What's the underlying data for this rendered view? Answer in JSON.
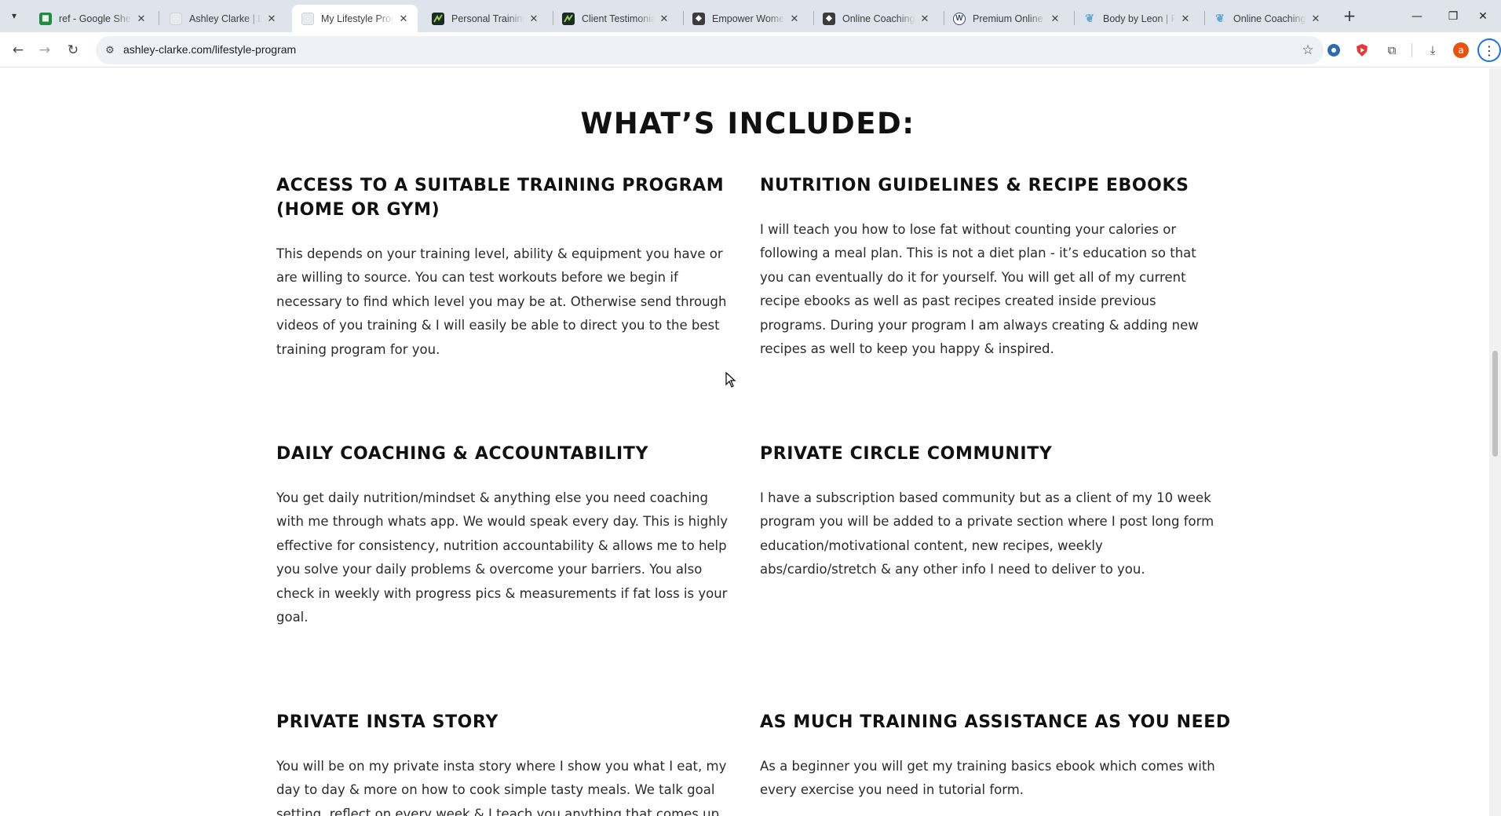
{
  "tabs": [
    {
      "title": "ref - Google Sheets",
      "favicon": "sheets-icon",
      "color": "#1e8e3e"
    },
    {
      "title": "Ashley Clarke | Lifestyle",
      "favicon": "page-icon",
      "color": "#e8eaed"
    },
    {
      "title": "My Lifestyle Program",
      "favicon": "page-icon",
      "color": "#e8eaed"
    },
    {
      "title": "Personal Training",
      "favicon": "zigzag-icon",
      "color": "#1b2a22"
    },
    {
      "title": "Client Testimonials",
      "favicon": "zigzag-icon",
      "color": "#1b2a22"
    },
    {
      "title": "Empower Women",
      "favicon": "cube-icon",
      "color": "#3c3c3c"
    },
    {
      "title": "Online Coaching",
      "favicon": "cube-icon",
      "color": "#3c3c3c"
    },
    {
      "title": "Premium Online P",
      "favicon": "wordpress-icon",
      "color": "#3b4a6b"
    },
    {
      "title": "Body by Leon | Pe",
      "favicon": "feather-icon",
      "color": "#5fa8d3"
    },
    {
      "title": "Online Coaching",
      "favicon": "feather-icon",
      "color": "#5fa8d3"
    }
  ],
  "toolbar": {
    "url": "ashley-clarke.com/lifestyle-program",
    "profile_initial": "a",
    "accent": "#1a73e8"
  },
  "page": {
    "heading": "WHAT’S INCLUDED:",
    "features": [
      {
        "title": "ACCESS TO A SUITABLE TRAINING PROGRAM (HOME OR GYM)",
        "body": "This depends on your training level, ability & equipment you have or are willing to source. You can test workouts before we begin if necessary to find which level you may be at. Otherwise send through videos of you training & I will easily be able to direct you to the best training program for you."
      },
      {
        "title": "NUTRITION GUIDELINES & RECIPE EBOOKS",
        "body": "I will teach you how to lose fat without counting your calories or following a meal plan. This is not a diet plan - it’s education so that you can eventually do it for yourself. You will get all of my current recipe ebooks as well as past recipes created inside previous programs. During your program I am always creating & adding new recipes as well to keep you happy & inspired."
      },
      {
        "title": "DAILY COACHING & ACCOUNTABILITY",
        "body": "You get daily nutrition/mindset & anything else you need coaching with me through whats app. We would speak every day. This is highly effective for consistency, nutrition accountability & allows me to help you solve your daily problems & overcome your barriers. You also check in weekly with progress pics & measurements if fat loss is your goal."
      },
      {
        "title": "PRIVATE CIRCLE COMMUNITY",
        "body": "I have a subscription based community but as a client of my 10 week program you will be added to a private section where I post long form education/motivational content, new recipes, weekly abs/cardio/stretch & any other info I need to deliver to you."
      },
      {
        "title": "PRIVATE INSTA STORY",
        "body": "You will be on my private insta story where I show you what I eat, my day to day & more on how to cook simple tasty meals. We talk goal setting, reflect on every week & I teach you anything that comes up."
      },
      {
        "title": "AS MUCH TRAINING ASSISTANCE AS YOU NEED",
        "body": "As a beginner you will get my training basics ebook which comes with every exercise you need in tutorial form."
      }
    ]
  }
}
